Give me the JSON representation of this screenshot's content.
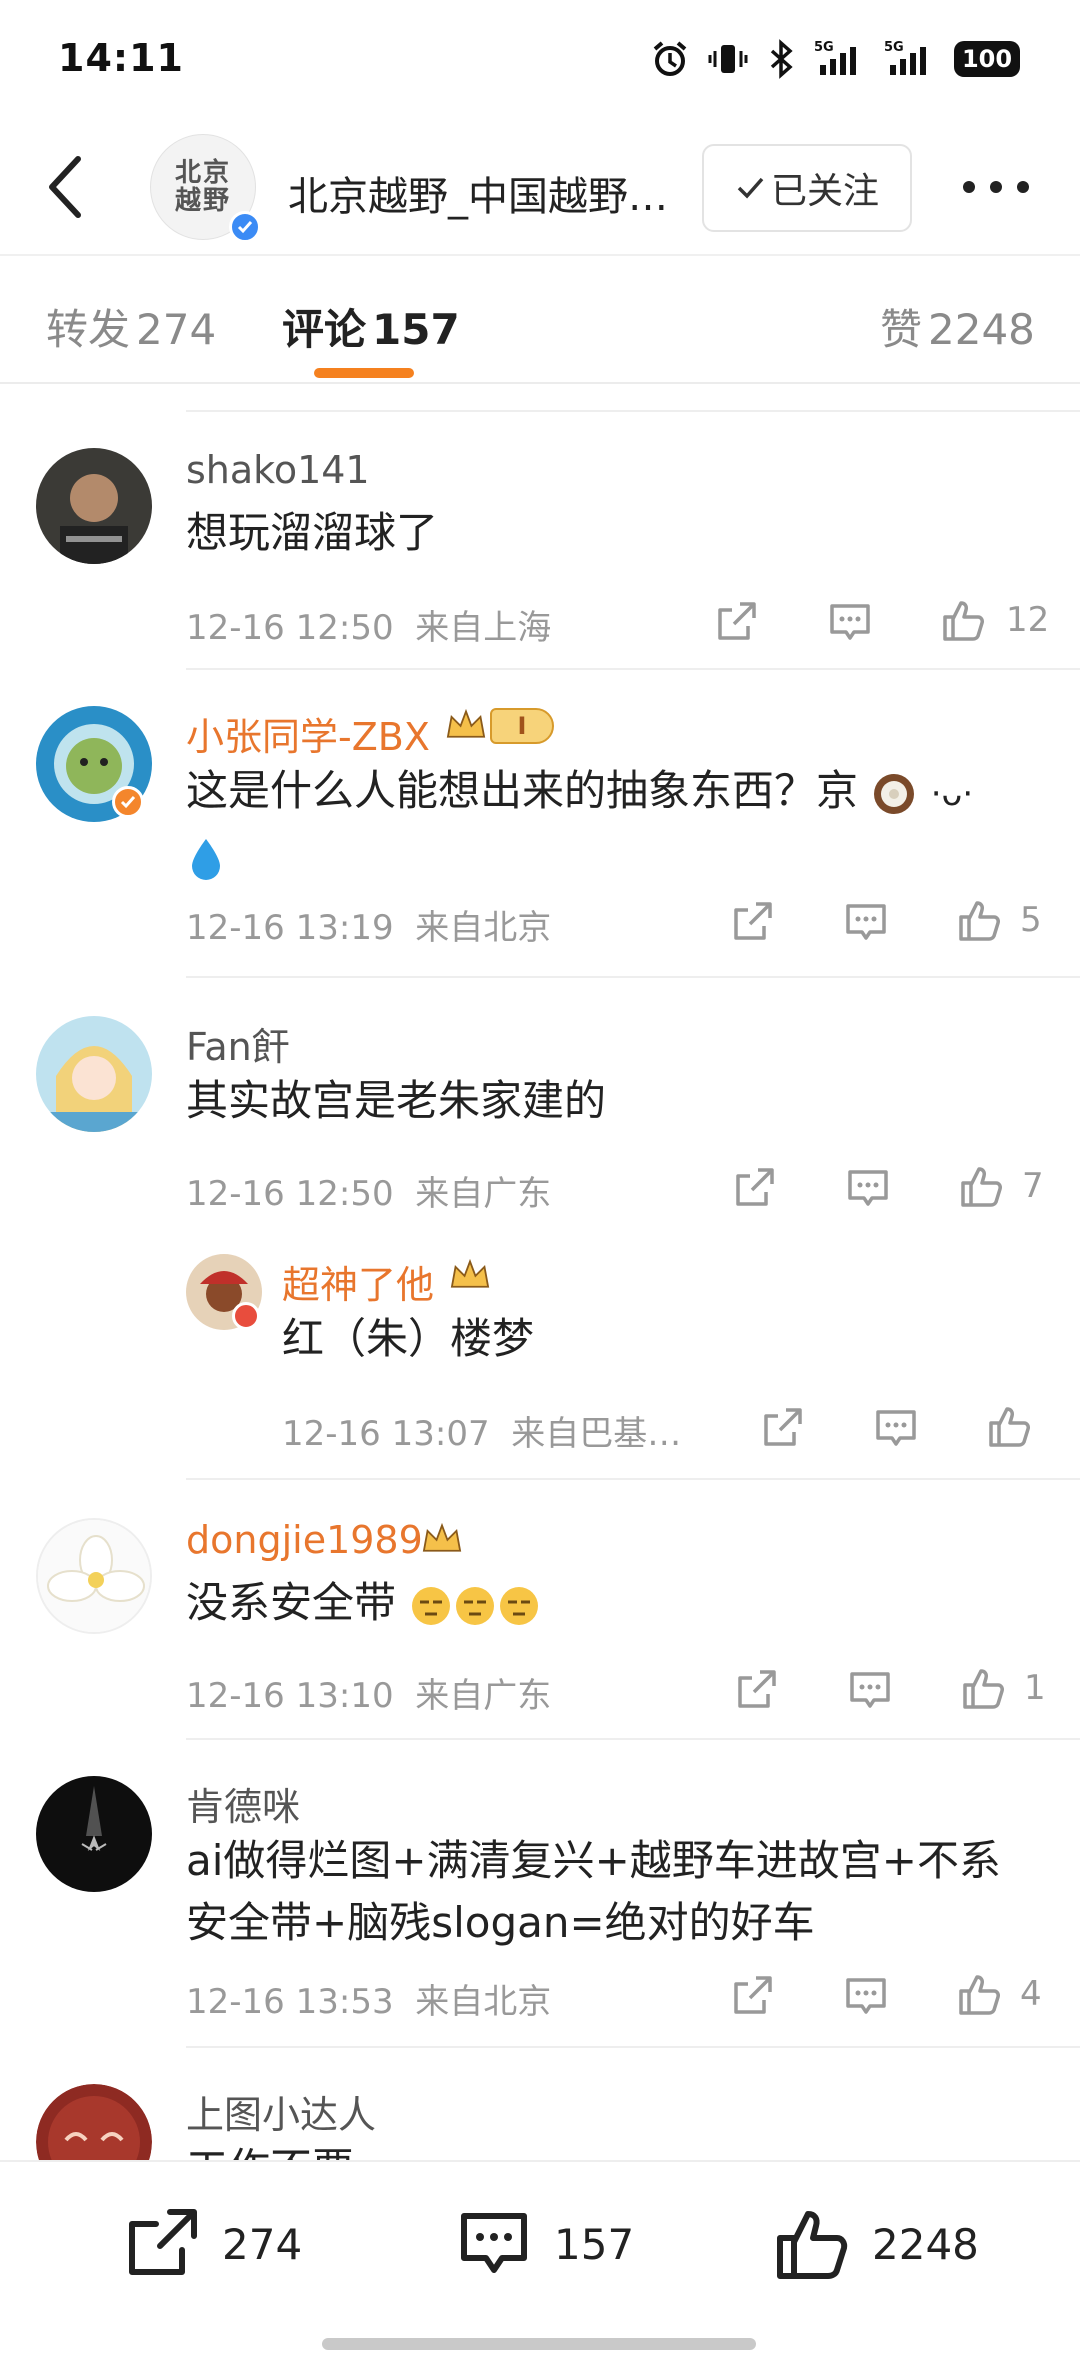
{
  "status_bar": {
    "time": "14:11",
    "battery": "100",
    "network": "5G"
  },
  "header": {
    "title": "北京越野_中国越野…",
    "avatar_logo_line1": "北京",
    "avatar_logo_line2": "越野",
    "follow_label": "已关注"
  },
  "tabs": [
    {
      "label": "转发",
      "count": "274"
    },
    {
      "label": "评论",
      "count": "157"
    },
    {
      "label": "赞",
      "count": "2248"
    }
  ],
  "comments": [
    {
      "user": "shako141",
      "text": "想玩溜溜球了",
      "time": "12-16 12:50",
      "location": "来自上海",
      "likes": "12"
    },
    {
      "user": "小张同学-ZBX",
      "text": "这是什么人能想出来的抽象东西？京",
      "time": "12-16 13:19",
      "location": "来自北京",
      "likes": "5",
      "level_badge": "I"
    },
    {
      "user": "Fan飦",
      "text": "其实故宫是老朱家建的",
      "time": "12-16 12:50",
      "location": "来自广东",
      "likes": "7",
      "reply": {
        "user": "超神了他",
        "text": "红（朱）楼梦",
        "time": "12-16 13:07",
        "location": "来自巴基…",
        "likes": ""
      }
    },
    {
      "user": "dongjie1989",
      "text": "没系安全带",
      "time": "12-16 13:10",
      "location": "来自广东",
      "likes": "1"
    },
    {
      "user": "肯德咪",
      "text_line1": "ai做得烂图+满清复兴+越野车进故宫+不系",
      "text_line2": "安全带+脑残slogan=绝对的好车",
      "time": "12-16 13:53",
      "location": "来自北京",
      "likes": "4"
    },
    {
      "user": "上图小达人",
      "text": "工作不要"
    }
  ],
  "bottom_bar": {
    "repost_count": "274",
    "comment_count": "157",
    "like_count": "2248"
  },
  "colors": {
    "accent": "#f5811f",
    "username_vip": "#e8762d",
    "meta": "#999999",
    "verified_blue": "#3b8bf5"
  },
  "icons": [
    "back-arrow-icon",
    "more-icon",
    "share-icon",
    "comment-icon",
    "like-icon",
    "verified-icon",
    "crown-icon"
  ]
}
